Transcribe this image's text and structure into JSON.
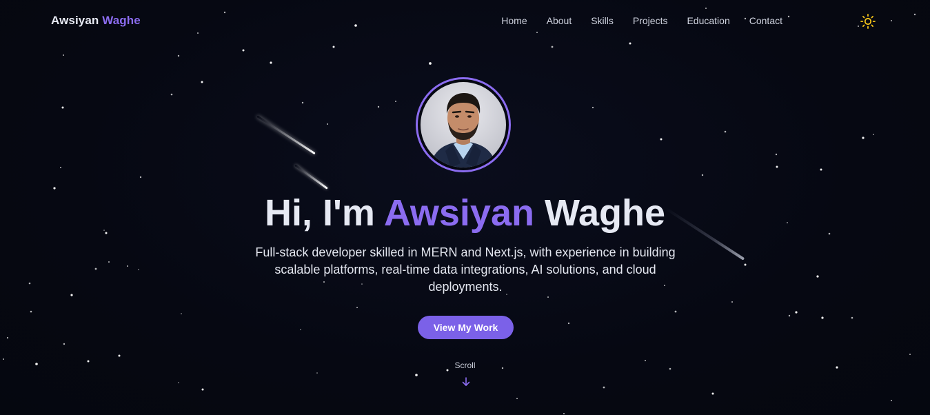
{
  "header": {
    "logo_first": "Awsiyan",
    "logo_last": "Waghe",
    "nav": [
      {
        "label": "Home"
      },
      {
        "label": "About"
      },
      {
        "label": "Skills"
      },
      {
        "label": "Projects"
      },
      {
        "label": "Education"
      },
      {
        "label": "Contact"
      }
    ],
    "theme_toggle_icon": "sun-icon"
  },
  "hero": {
    "greeting": "Hi, I'm",
    "first_name": "Awsiyan",
    "last_name": "Waghe",
    "description": "Full-stack developer skilled in MERN and Next.js, with experience in building scalable platforms, real-time data integrations, AI solutions, and cloud deployments.",
    "cta_label": "View My Work",
    "scroll_label": "Scroll",
    "scroll_icon": "arrow-down-icon",
    "avatar_icon": "profile-photo"
  },
  "colors": {
    "background": "#060812",
    "accent": "#8b6cf0",
    "button": "#7b61e8",
    "sun": "#f5c518",
    "text": "#e6e9f3"
  }
}
